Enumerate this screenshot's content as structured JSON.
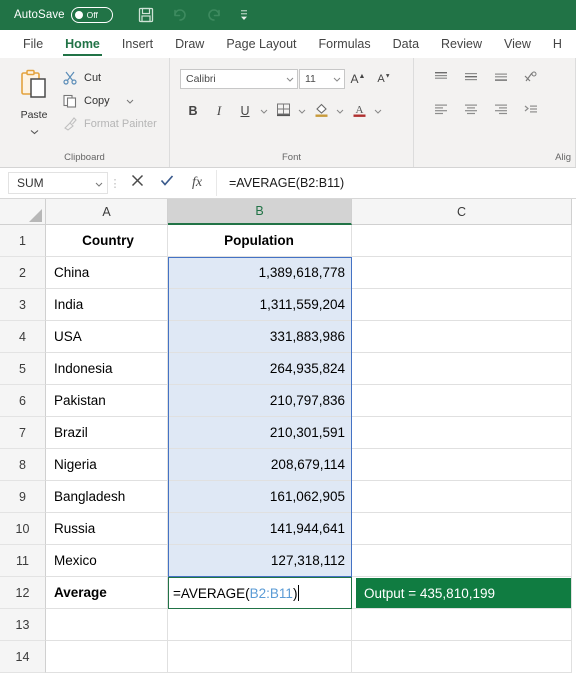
{
  "titlebar": {
    "autosave_label": "AutoSave",
    "autosave_state": "Off",
    "save_icon": "save-icon",
    "undo_icon": "undo-icon",
    "redo_icon": "redo-icon",
    "customize_icon": "customize-quick-access-icon",
    "bg_color": "#217346"
  },
  "tabs": [
    {
      "label": "File",
      "active": false
    },
    {
      "label": "Home",
      "active": true
    },
    {
      "label": "Insert",
      "active": false
    },
    {
      "label": "Draw",
      "active": false
    },
    {
      "label": "Page Layout",
      "active": false
    },
    {
      "label": "Formulas",
      "active": false
    },
    {
      "label": "Data",
      "active": false
    },
    {
      "label": "Review",
      "active": false
    },
    {
      "label": "View",
      "active": false
    },
    {
      "label": "H",
      "active": false
    }
  ],
  "ribbon": {
    "clipboard": {
      "group_label": "Clipboard",
      "paste_label": "Paste",
      "paste_icon": "paste-clipboard-icon",
      "cut_label": "Cut",
      "cut_icon": "scissors-icon",
      "copy_label": "Copy",
      "copy_icon": "copy-icon",
      "format_painter_label": "Format Painter",
      "format_painter_icon": "paintbrush-icon",
      "launcher_icon": "dialog-launcher-icon"
    },
    "font": {
      "group_label": "Font",
      "font_name": "Calibri",
      "font_size": "11",
      "grow_font_label": "A",
      "shrink_font_label": "A",
      "bold_label": "B",
      "italic_label": "I",
      "underline_label": "U",
      "borders_icon": "borders-icon",
      "fill_color_icon": "fill-color-icon",
      "font_color_icon": "font-color-icon",
      "launcher_icon": "dialog-launcher-icon"
    },
    "alignment": {
      "group_label": "Alig",
      "top_align_icon": "align-top-icon",
      "middle_align_icon": "align-middle-icon",
      "bottom_align_icon": "align-bottom-icon",
      "orientation_icon": "text-orientation-icon",
      "align_left_icon": "align-left-icon",
      "align_center_icon": "align-center-icon",
      "align_right_icon": "align-right-icon",
      "indent_icon": "increase-indent-icon"
    }
  },
  "formulabar": {
    "name_box_value": "SUM",
    "name_box_caret_icon": "chevron-down-icon",
    "cancel_icon": "cancel-x-icon",
    "enter_icon": "enter-check-icon",
    "insert_function_icon": "insert-function-icon",
    "insert_function_label": "fx",
    "formula_value": "=AVERAGE(B2:B11)"
  },
  "grid": {
    "columns": [
      "A",
      "B",
      "C"
    ],
    "selected_column": "B",
    "headers": {
      "a": "Country",
      "b": "Population",
      "c": ""
    },
    "rows": [
      {
        "num": "1",
        "a": "Country",
        "b": "Population",
        "header": true
      },
      {
        "num": "2",
        "a": "China",
        "b": "1,389,618,778",
        "header": false
      },
      {
        "num": "3",
        "a": "India",
        "b": "1,311,559,204",
        "header": false
      },
      {
        "num": "4",
        "a": "USA",
        "b": "331,883,986",
        "header": false
      },
      {
        "num": "5",
        "a": "Indonesia",
        "b": "264,935,824",
        "header": false
      },
      {
        "num": "6",
        "a": "Pakistan",
        "b": "210,797,836",
        "header": false
      },
      {
        "num": "7",
        "a": "Brazil",
        "b": "210,301,591",
        "header": false
      },
      {
        "num": "8",
        "a": "Nigeria",
        "b": "208,679,114",
        "header": false
      },
      {
        "num": "9",
        "a": "Bangladesh",
        "b": "161,062,905",
        "header": false
      },
      {
        "num": "10",
        "a": "Russia",
        "b": "141,944,641",
        "header": false
      },
      {
        "num": "11",
        "a": "Mexico",
        "b": "127,318,112",
        "header": false
      },
      {
        "num": "12",
        "a": "Average",
        "b": "",
        "header": false
      },
      {
        "num": "13",
        "a": "",
        "b": "",
        "header": false
      },
      {
        "num": "14",
        "a": "",
        "b": "",
        "header": false
      }
    ],
    "edit_cell": {
      "address": "B12",
      "formula_prefix": "=AVERAGE(",
      "formula_range": "B2:B11",
      "formula_suffix": ")"
    },
    "selection_range": "B2:B11",
    "selection_border_color": "#4472c4",
    "selection_fill_color": "#dfe8f5",
    "edit_border_color": "#217346"
  },
  "annotation": {
    "output_text": "Output = 435,810,199",
    "bg_color": "#107c41",
    "text_color": "#ffffff"
  }
}
